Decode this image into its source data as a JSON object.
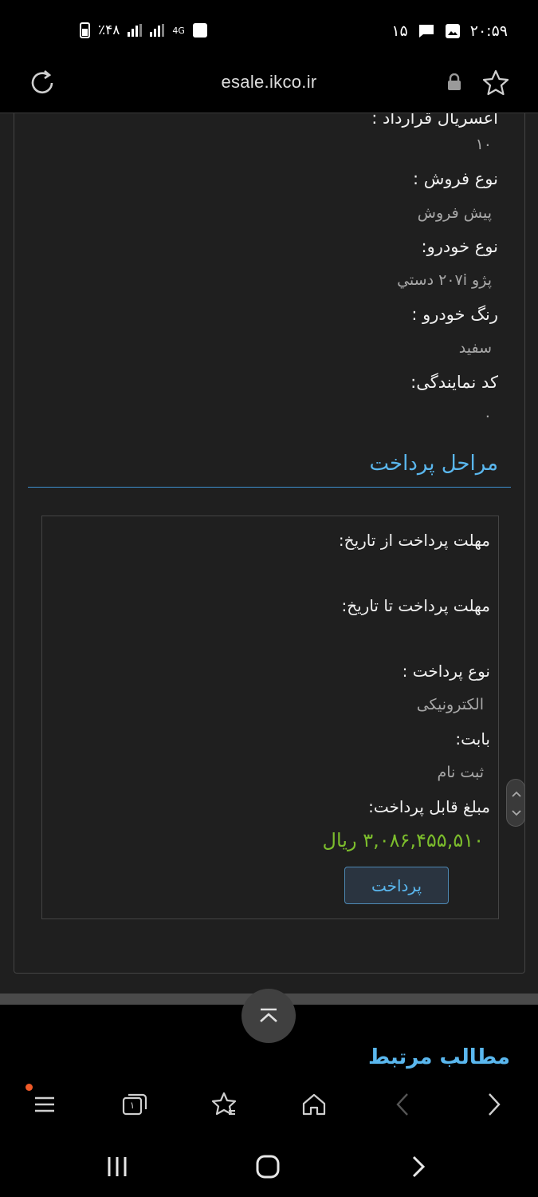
{
  "status_bar": {
    "time": "۲۰:۵۹",
    "notif_count": "۱۵",
    "battery": "٪۴۸",
    "network": "4G"
  },
  "browser": {
    "url": "esale.ikco.ir"
  },
  "details": {
    "partial_label": "اعسريال قرارداد :",
    "partial_value": "۱۰",
    "sale_type_label": "نوع فروش :",
    "sale_type_value": "پيش فروش",
    "car_type_label": "نوع خودرو:",
    "car_type_value": "پژو ۲۰۷i دستي",
    "car_color_label": "رنگ خودرو :",
    "car_color_value": "سفيد",
    "agency_code_label": "کد نمایندگی:",
    "agency_code_value": "۰"
  },
  "payment": {
    "section_title": "مراحل پرداخت",
    "from_date_label": "مهلت پرداخت از تاریخ:",
    "to_date_label": "مهلت پرداخت تا تاریخ:",
    "pay_type_label": "نوع پرداخت :",
    "pay_type_value": "الکترونیکی",
    "reason_label": "بابت:",
    "reason_value": "ثبت نام",
    "amount_label": "مبلغ قابل پرداخت:",
    "amount_value": "۳,۰۸۶,۴۵۵,۵۱۰ ريال",
    "pay_button": "پرداخت"
  },
  "related": {
    "title": "مطالب مرتبط"
  },
  "toolbar": {
    "tabs_count": "۱"
  }
}
